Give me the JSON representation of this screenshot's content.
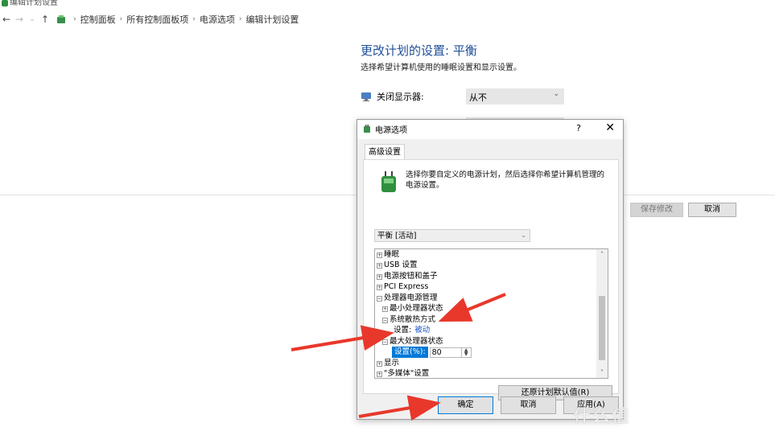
{
  "window": {
    "title": "编辑计划设置"
  },
  "nav": {
    "breadcrumb": [
      "控制面板",
      "所有控制面板项",
      "电源选项",
      "编辑计划设置"
    ]
  },
  "main": {
    "title": "更改计划的设置: 平衡",
    "subtitle": "选择希望计算机使用的睡眠设置和显示设置。",
    "display_off_label": "关闭显示器:",
    "display_off_value": "从不",
    "save_button": "保存修改",
    "cancel_button": "取消"
  },
  "dialog": {
    "title": "电源选项",
    "help": "?",
    "close": "✕",
    "tab": "高级设置",
    "intro": "选择你要自定义的电源计划，然后选择你希望计算机管理的电源设置。",
    "plan_select": "平衡 [活动]",
    "tree": {
      "sleep": "睡眠",
      "usb": "USB 设置",
      "power_buttons": "电源按钮和盖子",
      "pci": "PCI Express",
      "cpu_mgmt": "处理器电源管理",
      "min_cpu": "最小处理器状态",
      "cooling": "系统散热方式",
      "cooling_setting_label": "设置:",
      "cooling_setting_value": "被动",
      "max_cpu": "最大处理器状态",
      "max_cpu_setting_label": "设置(%):",
      "max_cpu_setting_value": "80",
      "display": "显示",
      "multimedia": "\"多媒体\"设置"
    },
    "restore_button": "还原计划默认值(R)",
    "ok_button": "确定",
    "cancel_button": "取消",
    "apply_button": "应用(A)"
  },
  "watermark": "什么值",
  "colors": {
    "title_blue": "#1e4e99",
    "selection_blue": "#0078d7",
    "arrow_red": "#e8382b",
    "link_blue": "#1a56c6"
  }
}
